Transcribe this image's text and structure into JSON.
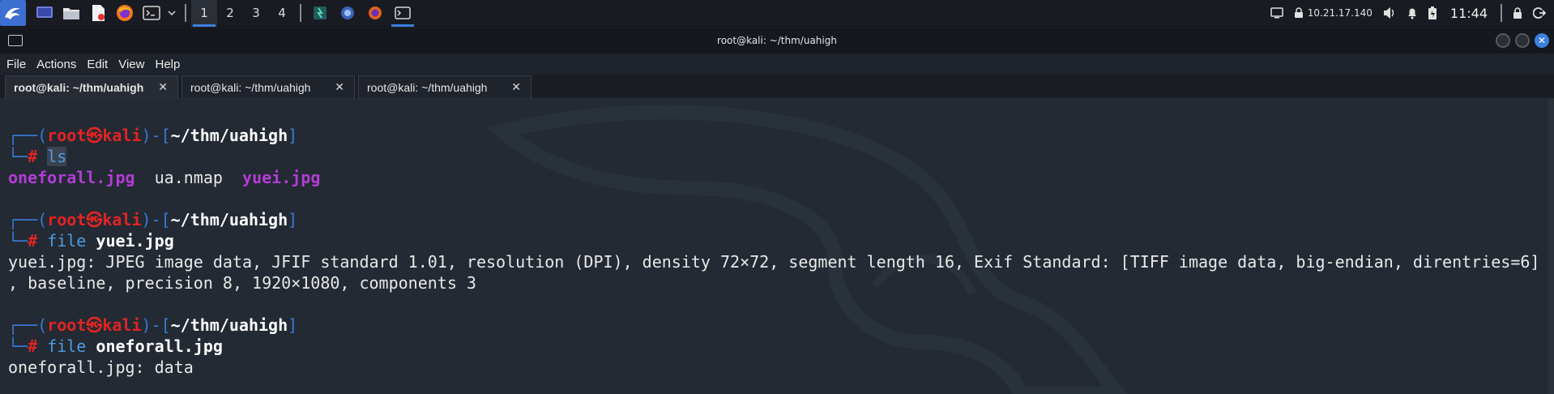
{
  "panel": {
    "workspaces": [
      "1",
      "2",
      "3",
      "4"
    ],
    "active_workspace": "1",
    "ip_address": "10.21.17.140",
    "clock": "11:44"
  },
  "window": {
    "title": "root@kali: ~/thm/uahigh",
    "close_glyph": "✕"
  },
  "menu": [
    "File",
    "Actions",
    "Edit",
    "View",
    "Help"
  ],
  "tabs": [
    {
      "label": "root@kali: ~/thm/uahigh",
      "active": true
    },
    {
      "label": "root@kali: ~/thm/uahigh",
      "active": false
    },
    {
      "label": "root@kali: ~/thm/uahigh",
      "active": false
    }
  ],
  "tab_close_glyph": "✕",
  "terminal": {
    "prompt_user": "root",
    "prompt_symbol": "㉿",
    "prompt_host": "kali",
    "prompt_path": "~/thm/uahigh",
    "prompt_hash": "#",
    "blocks": [
      {
        "command": "ls",
        "argument": "",
        "output": []
      },
      {
        "command": "file",
        "argument": "yuei.jpg",
        "output": [
          "yuei.jpg: JPEG image data, JFIF standard 1.01, resolution (DPI), density 72×72, segment length 16, Exif Standard: [TIFF image data, big-endian, direntries=6]",
          ", baseline, precision 8, 1920×1080, components 3"
        ]
      },
      {
        "command": "file",
        "argument": "oneforall.jpg",
        "output": [
          "oneforall.jpg: data"
        ]
      }
    ],
    "ls_output": {
      "file1": "oneforall.jpg",
      "file2": "ua.nmap",
      "file3": "yuei.jpg"
    }
  },
  "colors": {
    "accent": "#3b7fe0",
    "prompt_red": "#e02424",
    "prompt_box": "#3a79d6",
    "image_file": "#b23dd6"
  }
}
